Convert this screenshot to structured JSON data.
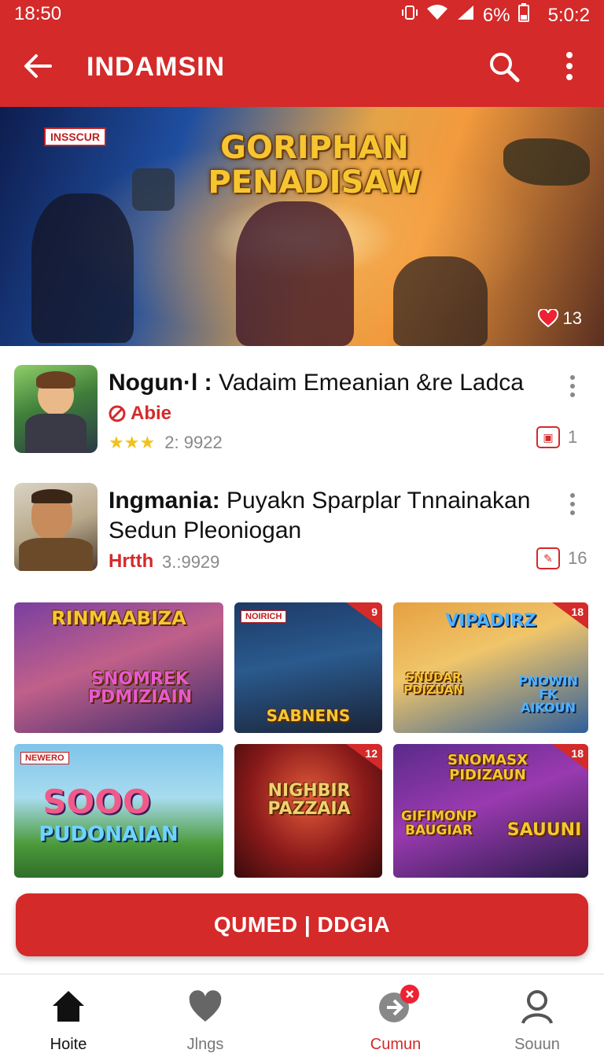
{
  "status_bar": {
    "time": "18:50",
    "battery": "6%",
    "clock_right": "5:0:2"
  },
  "app_bar": {
    "title": "INDAMSIN"
  },
  "hero": {
    "badge": "INSSCUR",
    "game_title_line1": "GORIPHAN",
    "game_title_line2": "PENADISAW",
    "likes": "13"
  },
  "list": [
    {
      "title_bold": "Nogun·l :",
      "title_rest": " Vadaim Emeanian &re Ladca",
      "publisher": "Abie",
      "stars": "★★★",
      "rating": "2: 9922",
      "count": "1"
    },
    {
      "title_bold": "Ingmania:",
      "title_rest": " Puyakn Sparplar Tnnainakan Sedun Pleoniogan",
      "publisher": "Hrtth",
      "rating": "3.:9929",
      "count": "16"
    }
  ],
  "grid": [
    {
      "label_top": "RINMAABIZA",
      "label_bottom": "SNOMREK PDMIZIAIN"
    },
    {
      "tag": "NOIRICH",
      "age": "9",
      "label_bottom": "SABNENS"
    },
    {
      "age": "18",
      "label_top": "VIPADIRZ",
      "label_left": "SNUDAR PDIZUAN",
      "label_right": "PNOWIN FK AIKOUN"
    },
    {
      "tag": "NEWERO",
      "label_top": "SOOO",
      "label_bottom": "PUDONAIAN"
    },
    {
      "age": "12",
      "label_top": "NIGHBIR PAZZAIA"
    },
    {
      "age": "18",
      "label_top": "SNOMASX PIDIZAUN",
      "label_left": "GIFIMONP BAUGIAR",
      "label_right": "SAUUNI"
    }
  ],
  "cta": {
    "label": "QUMED | DDGIA"
  },
  "bottom_nav": [
    {
      "label": "Hoite"
    },
    {
      "label": "Jlngs"
    },
    {
      "label": "Cumun",
      "badge": "x"
    },
    {
      "label": "Souun"
    }
  ],
  "colors": {
    "primary": "#d42a2a",
    "text": "#111111",
    "muted": "#888888"
  }
}
